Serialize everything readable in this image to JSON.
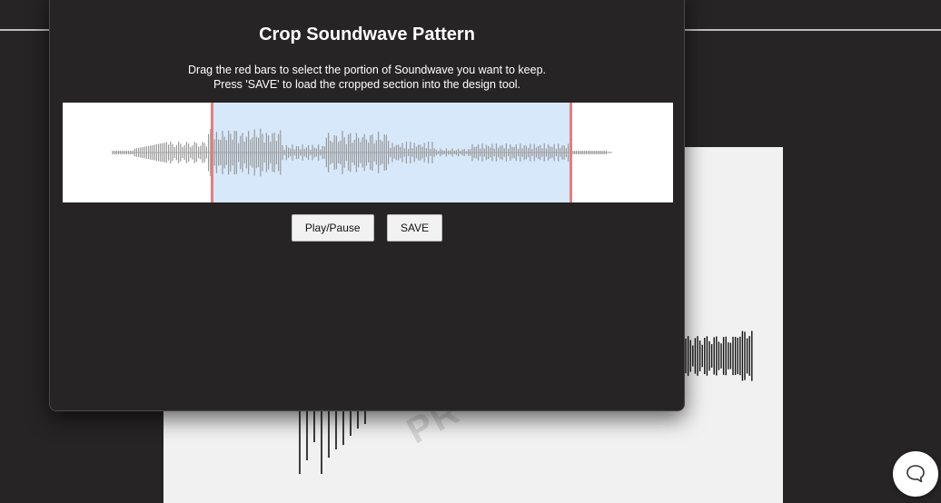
{
  "modal": {
    "title": "Crop Soundwave Pattern",
    "instruction_line1": "Drag the red bars to select the portion of Soundwave you want to keep.",
    "instruction_line2": "Press 'SAVE' to load the cropped section into the design tool."
  },
  "controls": {
    "play_pause_label": "Play/Pause",
    "save_label": "SAVE"
  },
  "selection": {
    "start_fraction": 0.244,
    "end_fraction": 0.832
  },
  "preview": {
    "watermark_text": "PR"
  },
  "icons": {
    "chat": "chat-bubble-icon"
  },
  "colors": {
    "background": "#262424",
    "handle": "#e08080",
    "selection": "#d7e8fa",
    "waveform": "#9a9a9a"
  }
}
